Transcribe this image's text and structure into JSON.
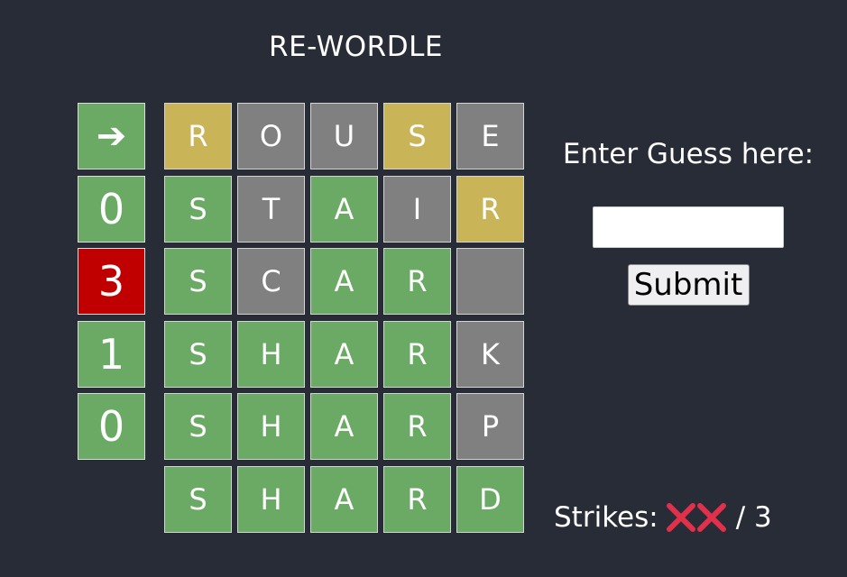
{
  "app": {
    "title": "RE-WORDLE"
  },
  "colors": {
    "correct": "#6aaa64",
    "present": "#c9b458",
    "absent": "#808080",
    "wrong": "#c00000",
    "strike": "#e0304a"
  },
  "side_column": [
    {
      "text": "➔",
      "state": "correct",
      "icon": "arrow-right-icon"
    },
    {
      "text": "0",
      "state": "correct"
    },
    {
      "text": "3",
      "state": "wrong"
    },
    {
      "text": "1",
      "state": "correct"
    },
    {
      "text": "0",
      "state": "correct"
    }
  ],
  "board": [
    [
      {
        "letter": "R",
        "state": "present"
      },
      {
        "letter": "O",
        "state": "absent"
      },
      {
        "letter": "U",
        "state": "absent"
      },
      {
        "letter": "S",
        "state": "present"
      },
      {
        "letter": "E",
        "state": "absent"
      }
    ],
    [
      {
        "letter": "S",
        "state": "correct"
      },
      {
        "letter": "T",
        "state": "absent"
      },
      {
        "letter": "A",
        "state": "correct"
      },
      {
        "letter": "I",
        "state": "absent"
      },
      {
        "letter": "R",
        "state": "present"
      }
    ],
    [
      {
        "letter": "S",
        "state": "correct"
      },
      {
        "letter": "C",
        "state": "absent"
      },
      {
        "letter": "A",
        "state": "correct"
      },
      {
        "letter": "R",
        "state": "correct"
      },
      {
        "letter": "",
        "state": "absent"
      }
    ],
    [
      {
        "letter": "S",
        "state": "correct"
      },
      {
        "letter": "H",
        "state": "correct"
      },
      {
        "letter": "A",
        "state": "correct"
      },
      {
        "letter": "R",
        "state": "correct"
      },
      {
        "letter": "K",
        "state": "absent"
      }
    ],
    [
      {
        "letter": "S",
        "state": "correct"
      },
      {
        "letter": "H",
        "state": "correct"
      },
      {
        "letter": "A",
        "state": "correct"
      },
      {
        "letter": "R",
        "state": "correct"
      },
      {
        "letter": "P",
        "state": "absent"
      }
    ],
    [
      {
        "letter": "S",
        "state": "correct"
      },
      {
        "letter": "H",
        "state": "correct"
      },
      {
        "letter": "A",
        "state": "correct"
      },
      {
        "letter": "R",
        "state": "correct"
      },
      {
        "letter": "D",
        "state": "correct"
      }
    ]
  ],
  "guess_panel": {
    "prompt": "Enter Guess here:",
    "input_value": "",
    "submit_label": "Submit"
  },
  "strikes": {
    "label": "Strikes:",
    "count": 2,
    "max_text": "/ 3",
    "icon": "x-mark-icon"
  }
}
